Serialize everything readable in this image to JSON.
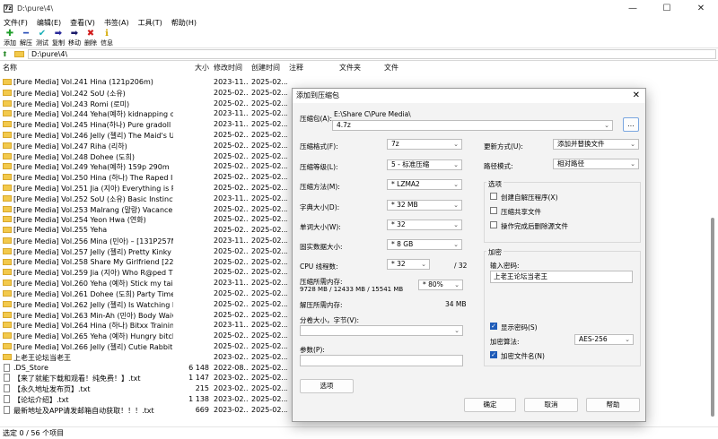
{
  "window": {
    "title": "D:\\pure\\4\\",
    "app_icon": "7z",
    "controls": [
      "—",
      "☐",
      "✕"
    ]
  },
  "menu": [
    "文件(F)",
    "编辑(E)",
    "查看(V)",
    "书签(A)",
    "工具(T)",
    "帮助(H)"
  ],
  "toolbar": [
    {
      "label": "添加",
      "icon": "add-icon",
      "glyph": "✚",
      "color": "#1f9e2a"
    },
    {
      "label": "解压",
      "icon": "extract-icon",
      "glyph": "━",
      "color": "#2a4fb8"
    },
    {
      "label": "测试",
      "icon": "test-icon",
      "glyph": "✔",
      "color": "#1ab0b8"
    },
    {
      "label": "复制",
      "icon": "copy-icon",
      "glyph": "➡",
      "color": "#2a2a9a"
    },
    {
      "label": "移动",
      "icon": "move-icon",
      "glyph": "➡",
      "color": "#1a1a6a"
    },
    {
      "label": "删除",
      "icon": "delete-icon",
      "glyph": "✖",
      "color": "#d11a1a"
    },
    {
      "label": "信息",
      "icon": "info-icon",
      "glyph": "ℹ",
      "color": "#d4a800"
    }
  ],
  "address": "D:\\pure\\4\\",
  "columns": {
    "name": "名称",
    "size": "大小",
    "modified": "修改时间",
    "created": "创建时间",
    "comment": "注释",
    "folders": "文件夹",
    "files": "文件"
  },
  "files": [
    {
      "type": "folder",
      "name": "[Pure Media] Vol.241 Hina (121p206m)",
      "size": "",
      "modified": "2023-11...",
      "created": "2025-02..."
    },
    {
      "type": "folder",
      "name": "[Pure Media] Vol.242 SoU (소유)",
      "size": "",
      "modified": "2025-02...",
      "created": "2025-02..."
    },
    {
      "type": "folder",
      "name": "[Pure Media] Vol.243 Romi (로미)",
      "size": "",
      "modified": "2025-02...",
      "created": "2025-02..."
    },
    {
      "type": "folder",
      "name": "[Pure Media] Vol.244 Yeha(예하) kidnapping offi...",
      "size": "",
      "modified": "2023-11...",
      "created": "2025-02..."
    },
    {
      "type": "folder",
      "name": "[Pure Media] Vol.245 Hina(하나) Pure gradoll (1...",
      "size": "",
      "modified": "2023-11...",
      "created": "2025-02..."
    },
    {
      "type": "folder",
      "name": "[Pure Media] Vol.246 Jelly (젤리) The Maid's Uni...",
      "size": "",
      "modified": "2025-02...",
      "created": "2025-02..."
    },
    {
      "type": "folder",
      "name": "[Pure Media] Vol.247 Riha (리하)",
      "size": "",
      "modified": "2025-02...",
      "created": "2025-02..."
    },
    {
      "type": "folder",
      "name": "[Pure Media] Vol.248 Dohee (도희)",
      "size": "",
      "modified": "2025-02...",
      "created": "2025-02..."
    },
    {
      "type": "folder",
      "name": "[Pure Media] Vol.249 Yeha(예하) 159p 290m",
      "size": "",
      "modified": "2025-02...",
      "created": "2025-02..."
    },
    {
      "type": "folder",
      "name": "[Pure Media] Vol.250 Hina (하나) The Raped Infl...",
      "size": "",
      "modified": "2025-02...",
      "created": "2025-02..."
    },
    {
      "type": "folder",
      "name": "[Pure Media] Vol.251 Jia (지아) Everything is Pin...",
      "size": "",
      "modified": "2025-02...",
      "created": "2025-02..."
    },
    {
      "type": "folder",
      "name": "[Pure Media] Vol.252 SoU (소유) Basic Instinct & ...",
      "size": "",
      "modified": "2023-11...",
      "created": "2025-02..."
    },
    {
      "type": "folder",
      "name": "[Pure Media] Vol.253 Malrang (말랑) Vacance",
      "size": "",
      "modified": "2025-02...",
      "created": "2025-02..."
    },
    {
      "type": "folder",
      "name": "[Pure Media] Vol.254 Yeon Hwa (연화)",
      "size": "",
      "modified": "2025-02...",
      "created": "2025-02..."
    },
    {
      "type": "folder",
      "name": "[Pure Media] Vol.255 Yeha",
      "size": "",
      "modified": "2025-02...",
      "created": "2025-02..."
    },
    {
      "type": "folder",
      "name": "[Pure Media] Vol.256 Mina (민아) – [131P257M]",
      "size": "",
      "modified": "2023-11...",
      "created": "2025-02..."
    },
    {
      "type": "folder",
      "name": "[Pure Media] Vol.257 Jelly (젤리) Pretty Kinky Girl",
      "size": "",
      "modified": "2025-02...",
      "created": "2025-02..."
    },
    {
      "type": "folder",
      "name": "[Pure Media] Vol.258 Share My Girlfriend [227P...",
      "size": "",
      "modified": "2025-02...",
      "created": "2025-02..."
    },
    {
      "type": "folder",
      "name": "[Pure Media] Vol.259 Jia (지아) Who R@ped The...",
      "size": "",
      "modified": "2025-02...",
      "created": "2025-02..."
    },
    {
      "type": "folder",
      "name": "[Pure Media] Vol.260 Yeha (예하) Stick my tail in...",
      "size": "",
      "modified": "2023-11...",
      "created": "2025-02..."
    },
    {
      "type": "folder",
      "name": "[Pure Media] Vol.261 Dohee (도희) Party Time",
      "size": "",
      "modified": "2025-02...",
      "created": "2025-02..."
    },
    {
      "type": "folder",
      "name": "[Pure Media] Vol.262 Jelly (젤리) Is Watching Ero...",
      "size": "",
      "modified": "2025-02...",
      "created": "2025-02..."
    },
    {
      "type": "folder",
      "name": "[Pure Media] Vol.263 Min-Ah (민아) Body Waiver",
      "size": "",
      "modified": "2025-02...",
      "created": "2025-02..."
    },
    {
      "type": "folder",
      "name": "[Pure Media] Vol.264 Hina (하나) Bitxx Training ...",
      "size": "",
      "modified": "2023-11...",
      "created": "2025-02..."
    },
    {
      "type": "folder",
      "name": "[Pure Media] Vol.265 Yeha (예하) Hungry bitch i...",
      "size": "",
      "modified": "2025-02...",
      "created": "2025-02..."
    },
    {
      "type": "folder",
      "name": "[Pure Media] Vol.266 Jelly (젤리) Cutie Rabbit & ...",
      "size": "",
      "modified": "2025-02...",
      "created": "2025-02..."
    },
    {
      "type": "folder",
      "name": "上老王论坛当老王",
      "size": "",
      "modified": "2023-02...",
      "created": "2025-02..."
    },
    {
      "type": "file",
      "name": ".DS_Store",
      "size": "6 148",
      "modified": "2022-08...",
      "created": "2025-02..."
    },
    {
      "type": "file",
      "name": "【来了就能下载和观看！纯免费！】.txt",
      "size": "1 147",
      "modified": "2023-02...",
      "created": "2025-02..."
    },
    {
      "type": "file",
      "name": "【永久地址发布页】.txt",
      "size": "215",
      "modified": "2023-02...",
      "created": "2025-02..."
    },
    {
      "type": "file",
      "name": "【论坛介绍】.txt",
      "size": "1 138",
      "modified": "2023-02...",
      "created": "2025-02..."
    },
    {
      "type": "file",
      "name": "最新地址及APP请发邮箱自动获取！！！.txt",
      "size": "669",
      "modified": "2023-02...",
      "created": "2025-02..."
    }
  ],
  "status": "选定 0 / 56 个项目",
  "dialog": {
    "title": "添加到压缩包",
    "archive_label": "压缩包(A):",
    "archive_path": "E:\\Share C\\Pure Media\\",
    "archive_name": "4.7z",
    "browse_label": "...",
    "format_label": "压缩格式(F):",
    "format_value": "7z",
    "level_label": "压缩等级(L):",
    "level_value": "5 - 标准压缩",
    "method_label": "压缩方法(M):",
    "method_value": "* LZMA2",
    "dict_label": "字典大小(D):",
    "dict_value": "* 32 MB",
    "word_label": "单词大小(W):",
    "word_value": "* 32",
    "solid_label": "固实数据大小:",
    "solid_value": "* 8 GB",
    "threads_label": "CPU 线程数:",
    "threads_value": "* 32",
    "threads_max": "/ 32",
    "mem_label": "压缩所需内存:",
    "mem_detail": "9728 MB / 12433 MB / 15541 MB",
    "mem_value": "* 80%",
    "decomp_label": "解压所需内存:",
    "decomp_value": "34 MB",
    "split_label": "分卷大小，字节(V):",
    "split_value": "",
    "params_label": "参数(P):",
    "params_value": "",
    "options_btn": "选项",
    "update_label": "更新方式(U):",
    "update_value": "添加并替换文件",
    "pathmode_label": "路径模式:",
    "pathmode_value": "相对路径",
    "options_group": "选项",
    "opt_sfx": "创建自解压程序(X)",
    "opt_sfx_checked": false,
    "opt_shared": "压缩共享文件",
    "opt_shared_checked": false,
    "opt_delete": "操作完成后删除源文件",
    "opt_delete_checked": false,
    "encrypt_group": "加密",
    "password_label": "输入密码:",
    "password_value": "上老王论坛当老王",
    "show_password": "显示密码(S)",
    "show_password_checked": true,
    "enc_method_label": "加密算法:",
    "enc_method_value": "AES-256",
    "enc_names": "加密文件名(N)",
    "enc_names_checked": true,
    "ok": "确定",
    "cancel": "取消",
    "help": "帮助"
  }
}
